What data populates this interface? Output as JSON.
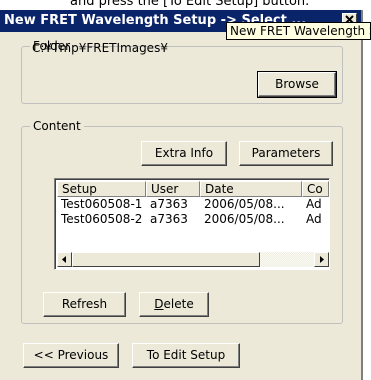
{
  "caption": {
    "text": "and press the [To Edit Setup] button."
  },
  "window": {
    "title": "New FRET Wavelength Setup -> Select ...",
    "tooltip": "New FRET Wavelength Setup -> Select"
  },
  "folder": {
    "legend": "Folder",
    "path": "C:¥Tmp¥FRETImages¥",
    "browse_label": "Browse"
  },
  "content": {
    "legend": "Content",
    "extra_info_label": "Extra Info",
    "parameters_label": "Parameters",
    "columns": [
      "Setup",
      "User",
      "Date",
      "Co"
    ],
    "rows": [
      [
        "Test060508-1",
        "a7363",
        "2006/05/08...",
        "Ad"
      ],
      [
        "Test060508-2",
        "a7363",
        "2006/05/08...",
        "Ad"
      ]
    ],
    "refresh_label": "Refresh",
    "delete_label": "Delete"
  },
  "footer": {
    "previous_label": "<< Previous",
    "to_edit_label": "To Edit Setup"
  }
}
